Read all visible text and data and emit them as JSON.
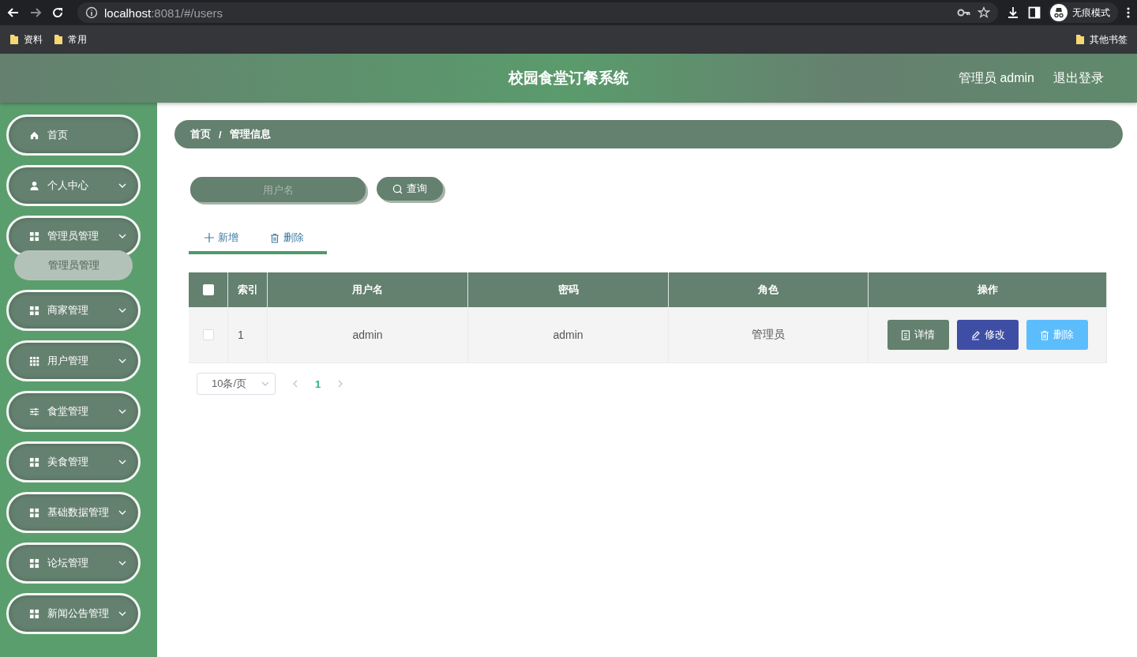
{
  "browser": {
    "url_host": "localhost",
    "url_rest": ":8081/#/users",
    "profile": "无痕模式",
    "bookmarks": [
      "资料",
      "常用"
    ],
    "other_bookmarks": "其他书签"
  },
  "header": {
    "title": "校园食堂订餐系统",
    "user": "管理员 admin",
    "logout": "退出登录"
  },
  "sidebar": {
    "items": [
      {
        "label": "首页",
        "kind": "home"
      },
      {
        "label": "个人中心",
        "kind": "user",
        "has_submenu": true
      },
      {
        "label": "管理员管理",
        "kind": "grid",
        "has_submenu": true,
        "expanded": true,
        "children": [
          {
            "label": "管理员管理"
          }
        ]
      },
      {
        "label": "商家管理",
        "kind": "grid",
        "has_submenu": true
      },
      {
        "label": "用户管理",
        "kind": "grid9",
        "has_submenu": true
      },
      {
        "label": "食堂管理",
        "kind": "sliders",
        "has_submenu": true
      },
      {
        "label": "美食管理",
        "kind": "grid",
        "has_submenu": true
      },
      {
        "label": "基础数据管理",
        "kind": "grid",
        "has_submenu": true
      },
      {
        "label": "论坛管理",
        "kind": "grid",
        "has_submenu": true
      },
      {
        "label": "新闻公告管理",
        "kind": "grid",
        "has_submenu": true
      }
    ]
  },
  "breadcrumb": {
    "items": [
      "首页",
      "管理信息"
    ],
    "separator": "/"
  },
  "search": {
    "placeholder": "用户名",
    "button": "查询"
  },
  "toolbar": [
    {
      "label": "新增",
      "kind": "add"
    },
    {
      "label": "删除",
      "kind": "delete"
    }
  ],
  "table": {
    "header_checked": false,
    "columns": [
      "索引",
      "用户名",
      "密码",
      "角色",
      "操作"
    ],
    "rows": [
      {
        "checked": false,
        "cells": [
          "1",
          "admin",
          "admin",
          "管理员"
        ],
        "actions": [
          {
            "label": "详情",
            "kind": "detail"
          },
          {
            "label": "修改",
            "kind": "edit"
          },
          {
            "label": "删除",
            "kind": "delete"
          }
        ]
      }
    ]
  },
  "pagination": {
    "page_size": "10条/页",
    "pages": [
      {
        "label": "1",
        "selected": true
      }
    ]
  }
}
